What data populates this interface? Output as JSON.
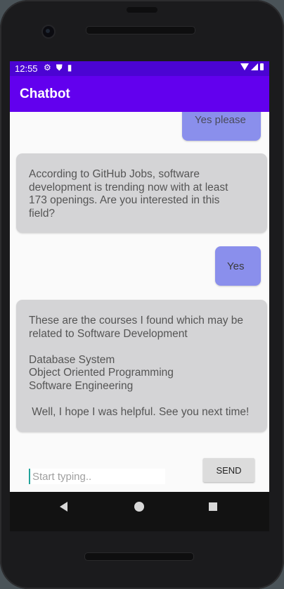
{
  "status_bar": {
    "time": "12:55",
    "left_icons": [
      "gear-icon",
      "shield-icon",
      "sd-card-icon"
    ],
    "right_icons": [
      "wifi-icon",
      "cellular-icon",
      "battery-icon"
    ]
  },
  "app_bar": {
    "title": "Chatbot"
  },
  "messages": [
    {
      "sender": "user",
      "text": "Yes please"
    },
    {
      "sender": "bot",
      "lines": [
        "According to GitHub Jobs, software",
        "development is trending now with at least",
        "173 openings. Are you interested in this",
        "field?"
      ]
    },
    {
      "sender": "user",
      "text": "Yes"
    },
    {
      "sender": "bot",
      "lines": [
        "These are the courses I found which may be",
        "related to Software Development",
        "",
        "Database System",
        "Object Oriented Programming",
        "Software Engineering",
        "",
        " Well, I hope I was helpful. See you next time!"
      ]
    }
  ],
  "input": {
    "placeholder": "Start typing..",
    "value": ""
  },
  "send_button": {
    "label": "SEND"
  },
  "nav_bar": {
    "icons": [
      "back-icon",
      "home-icon",
      "recents-icon"
    ]
  },
  "colors": {
    "status_bar": "#4b04d3",
    "app_bar": "#6200ee",
    "user_bubble": "#8a8fec",
    "bot_bubble": "#d4d4d6"
  }
}
